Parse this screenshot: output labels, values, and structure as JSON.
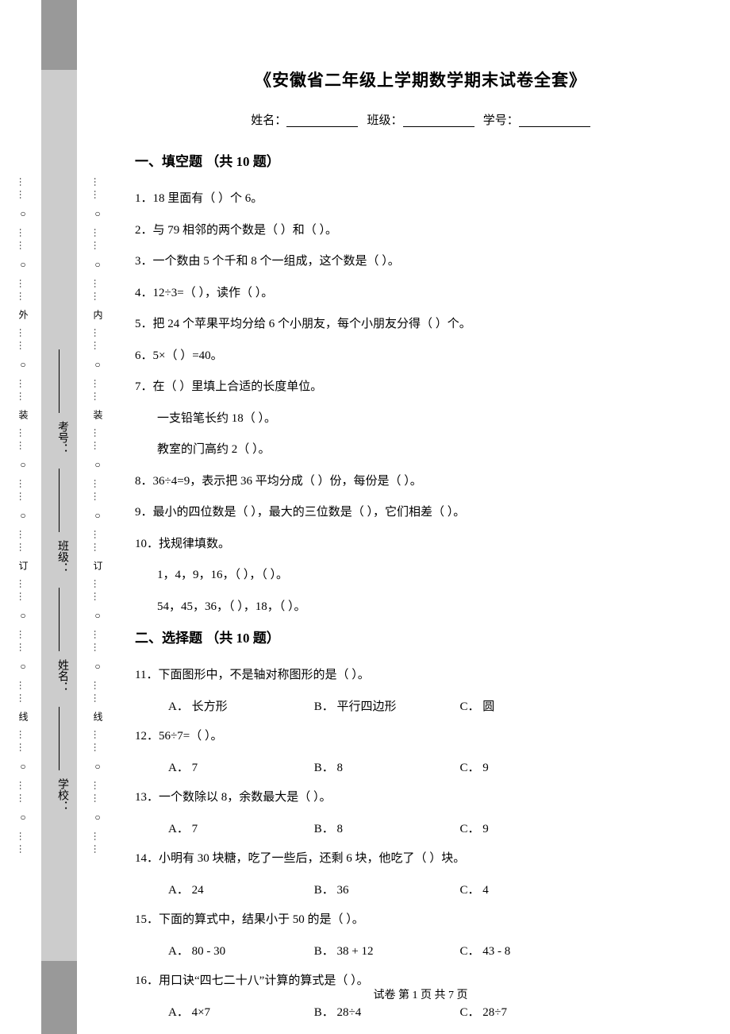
{
  "title": "《安徽省二年级上学期数学期末试卷全套》",
  "info": {
    "name_label": "姓名：",
    "class_label": "班级：",
    "id_label": "学号："
  },
  "binding": {
    "outer_text": "…… ○ …… ○ …… 外 …… ○ …… 装 …… ○ …… ○ …… 订 …… ○ …… ○ …… 线 …… ○ …… ○ ……",
    "inner_text": "…… ○ …… ○ …… 内 …… ○ …… 装 …… ○ …… ○ …… 订 …… ○ …… ○ …… 线 …… ○ …… ○ ……",
    "labels": {
      "school": "学校：",
      "name": "姓名：",
      "class": "班级：",
      "exam_id": "考号："
    }
  },
  "section1": {
    "title": "一、填空题 （共 10 题）",
    "q1": "1．18 里面有（  ）个 6。",
    "q2": "2．与 79 相邻的两个数是（  ）和（  ）。",
    "q3": "3．一个数由 5 个千和 8 个一组成，这个数是（  ）。",
    "q4": "4．12÷3=（  ），读作（      ）。",
    "q5": "5．把 24 个苹果平均分给 6 个小朋友，每个小朋友分得（  ）个。",
    "q6": "6．5×（  ）=40。",
    "q7": "7．在（  ）里填上合适的长度单位。",
    "q7a": "一支铅笔长约 18（  ）。",
    "q7b": "教室的门高约 2（  ）。",
    "q8": "8．36÷4=9，表示把 36 平均分成（  ）份，每份是（  ）。",
    "q9": "9．最小的四位数是（  ），最大的三位数是（  ），它们相差（  ）。",
    "q10": "10．找规律填数。",
    "q10a": "1，4，9，16，（  ），（  ）。",
    "q10b": "54，45，36，（  ），18，（  ）。"
  },
  "section2": {
    "title": "二、选择题 （共 10 题）",
    "q11": "11．下面图形中，不是轴对称图形的是（  ）。",
    "q11a": "A．  长方形",
    "q11b": "B．  平行四边形",
    "q11c": "C．  圆",
    "q12": "12．56÷7=（  ）。",
    "q12a": "A．  7",
    "q12b": "B．  8",
    "q12c": "C．  9",
    "q13": "13．一个数除以 8，余数最大是（  ）。",
    "q13a": "A．  7",
    "q13b": "B．  8",
    "q13c": "C．  9",
    "q14": "14．小明有 30 块糖，吃了一些后，还剩 6 块，他吃了（  ）块。",
    "q14a": "A．  24",
    "q14b": "B．  36",
    "q14c": "C．  4",
    "q15": "15．下面的算式中，结果小于 50 的是（  ）。",
    "q15a": "A．  80 - 30",
    "q15b": "B．  38 + 12",
    "q15c": "C．  43 - 8",
    "q16": "16．用口诀“四七二十八”计算的算式是（  ）。",
    "q16a": "A．  4×7",
    "q16b": "B．  28÷4",
    "q16c": "C．  28÷7"
  },
  "footer": "试卷 第 1 页 共 7 页"
}
